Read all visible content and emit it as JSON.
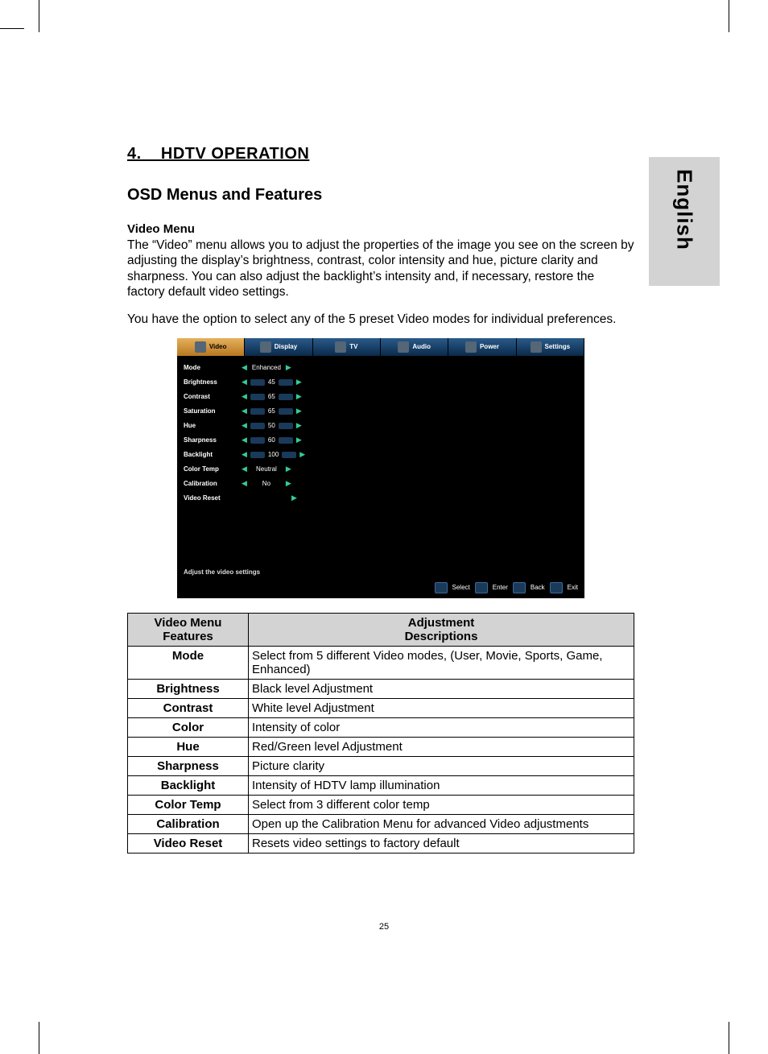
{
  "side_tab": "English",
  "section_heading": "4.    HDTV OPERATION",
  "subsection_heading": "OSD Menus and Features",
  "video_menu_heading": "Video Menu",
  "paragraph1": "The “Video” menu allows you to adjust the properties of the image you see on the screen by adjusting the display’s brightness, contrast, color intensity and hue, picture clarity and sharpness. You can also adjust the backlight’s intensity and, if necessary, restore the factory default video settings.",
  "paragraph2": "You have the option to select any of the 5 preset Video modes for individual preferences.",
  "osd": {
    "tabs": [
      "Video",
      "Display",
      "TV",
      "Audio",
      "Power",
      "Settings"
    ],
    "rows": [
      {
        "label": "Mode",
        "value": "Enhanced",
        "type": "text"
      },
      {
        "label": "Brightness",
        "value": "45",
        "type": "slider"
      },
      {
        "label": "Contrast",
        "value": "65",
        "type": "slider"
      },
      {
        "label": "Saturation",
        "value": "65",
        "type": "slider"
      },
      {
        "label": "Hue",
        "value": "50",
        "type": "slider"
      },
      {
        "label": "Sharpness",
        "value": "60",
        "type": "slider"
      },
      {
        "label": "Backlight",
        "value": "100",
        "type": "slider"
      },
      {
        "label": "Color Temp",
        "value": "Neutral",
        "type": "text"
      },
      {
        "label": "Calibration",
        "value": "No",
        "type": "text"
      },
      {
        "label": "Video Reset",
        "value": "",
        "type": "arrow"
      }
    ],
    "hint": "Adjust the video settings",
    "footer": [
      "Select",
      "Enter",
      "Back",
      "Exit"
    ]
  },
  "table": {
    "header_left_line1": "Video Menu",
    "header_left_line2": "Features",
    "header_right_line1": "Adjustment",
    "header_right_line2": "Descriptions",
    "rows": [
      {
        "name": "Mode",
        "desc": "Select from  5 different Video modes, (User, Movie, Sports, Game, Enhanced)"
      },
      {
        "name": "Brightness",
        "desc": "Black level Adjustment"
      },
      {
        "name": "Contrast",
        "desc": "White level Adjustment"
      },
      {
        "name": "Color",
        "desc": "Intensity of color"
      },
      {
        "name": "Hue",
        "desc": "Red/Green level Adjustment"
      },
      {
        "name": "Sharpness",
        "desc": "Picture clarity"
      },
      {
        "name": "Backlight",
        "desc": "Intensity of HDTV lamp illumination"
      },
      {
        "name": "Color Temp",
        "desc": "Select from 3 different color temp"
      },
      {
        "name": "Calibration",
        "desc": "Open up the Calibration  Menu for advanced Video adjustments"
      },
      {
        "name": "Video Reset",
        "desc": "Resets video settings to factory default"
      }
    ]
  },
  "page_number": "25"
}
